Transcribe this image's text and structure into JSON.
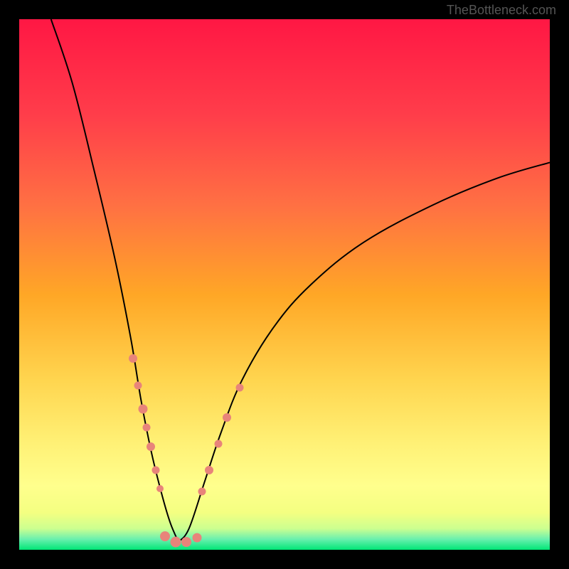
{
  "watermark": "TheBottleneck.com",
  "chart_data": {
    "type": "line",
    "title": "",
    "xlabel": "",
    "ylabel": "",
    "xlim": [
      0,
      100
    ],
    "ylim": [
      0,
      100
    ],
    "gradient_colors": {
      "top": "#ff1744",
      "upper_mid": "#ff6b35",
      "mid": "#ffc107",
      "lower_mid": "#ffeb3b",
      "light": "#ffff8d",
      "pale": "#f0f4c3",
      "bottom": "#00e676"
    },
    "curve_left": [
      {
        "x": 6,
        "y": 100
      },
      {
        "x": 10,
        "y": 88
      },
      {
        "x": 14,
        "y": 72
      },
      {
        "x": 18,
        "y": 55
      },
      {
        "x": 21,
        "y": 40
      },
      {
        "x": 23,
        "y": 28
      },
      {
        "x": 25,
        "y": 18
      },
      {
        "x": 27,
        "y": 10
      },
      {
        "x": 28.5,
        "y": 5
      },
      {
        "x": 30,
        "y": 1.5
      }
    ],
    "curve_right": [
      {
        "x": 30,
        "y": 1.5
      },
      {
        "x": 32,
        "y": 4
      },
      {
        "x": 35,
        "y": 13
      },
      {
        "x": 38,
        "y": 22
      },
      {
        "x": 42,
        "y": 32
      },
      {
        "x": 48,
        "y": 42
      },
      {
        "x": 55,
        "y": 50
      },
      {
        "x": 65,
        "y": 58
      },
      {
        "x": 78,
        "y": 65
      },
      {
        "x": 90,
        "y": 70
      },
      {
        "x": 100,
        "y": 73
      }
    ],
    "data_points_left": [
      {
        "x": 21.5,
        "y": 36,
        "size": 12
      },
      {
        "x": 22.4,
        "y": 31,
        "size": 11
      },
      {
        "x": 23.3,
        "y": 26.5,
        "size": 13
      },
      {
        "x": 24.0,
        "y": 23,
        "size": 11
      },
      {
        "x": 24.8,
        "y": 19.5,
        "size": 12
      },
      {
        "x": 25.8,
        "y": 15,
        "size": 11
      },
      {
        "x": 26.5,
        "y": 11.5,
        "size": 10
      }
    ],
    "data_points_right": [
      {
        "x": 34.5,
        "y": 11,
        "size": 11
      },
      {
        "x": 35.8,
        "y": 15,
        "size": 12
      },
      {
        "x": 37.5,
        "y": 20,
        "size": 11
      },
      {
        "x": 39.2,
        "y": 25,
        "size": 12
      },
      {
        "x": 41.5,
        "y": 30.5,
        "size": 11
      }
    ],
    "data_points_bottom": [
      {
        "x": 27.5,
        "y": 2.5,
        "size": 14
      },
      {
        "x": 29.5,
        "y": 1.5,
        "size": 15
      },
      {
        "x": 31.5,
        "y": 1.5,
        "size": 14
      },
      {
        "x": 33.5,
        "y": 2.3,
        "size": 13
      }
    ]
  }
}
